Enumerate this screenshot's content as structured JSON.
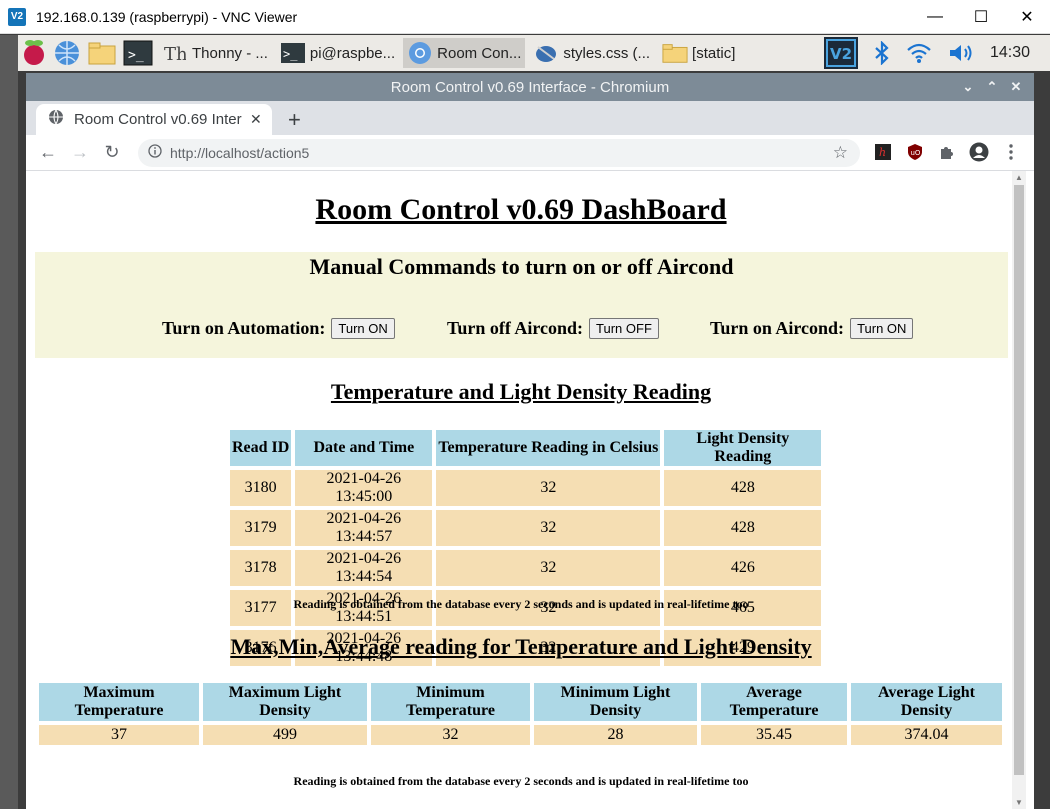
{
  "vnc": {
    "title": "192.168.0.139 (raspberrypi) - VNC Viewer"
  },
  "panel": {
    "tasks": [
      "Thonny  -  ...",
      "pi@raspbe...",
      "Room Con...",
      "styles.css (...",
      "[static]"
    ],
    "clock": "14:30"
  },
  "chrome": {
    "window_title": "Room Control v0.69 Interface - Chromium",
    "tab_title": "Room Control v0.69 Inter",
    "url": "http://localhost/action5"
  },
  "page": {
    "title": "Room Control v0.69 DashBoard",
    "manual": {
      "title": "Manual Commands to turn on or off Aircond",
      "commands": [
        {
          "label": "Turn on Automation:",
          "button": "Turn ON"
        },
        {
          "label": "Turn off Aircond:",
          "button": "Turn OFF"
        },
        {
          "label": "Turn on Aircond:",
          "button": "Turn ON"
        }
      ]
    },
    "readings_title": "Temperature and Light Density Reading",
    "readings_headers": [
      "Read ID",
      "Date and Time",
      "Temperature Reading in Celsius",
      "Light Density Reading"
    ],
    "readings": [
      [
        "3180",
        "2021-04-26 13:45:00",
        "32",
        "428"
      ],
      [
        "3179",
        "2021-04-26 13:44:57",
        "32",
        "428"
      ],
      [
        "3178",
        "2021-04-26 13:44:54",
        "32",
        "426"
      ],
      [
        "3177",
        "2021-04-26 13:44:51",
        "32",
        "465"
      ],
      [
        "3176",
        "2021-04-26 13:44:48",
        "32",
        "429"
      ]
    ],
    "note": "Reading is obtained from the database every 2 seconds and is updated in real-lifetime too",
    "stats_title": "Max,Min,Average reading for Temperature and Light Density",
    "stats_headers": [
      "Maximum Temperature",
      "Maximum Light Density",
      "Minimum Temperature",
      "Minimum Light Density",
      "Average Temperature",
      "Average Light Density"
    ],
    "stats_values": [
      "37",
      "499",
      "32",
      "28",
      "35.45",
      "374.04"
    ]
  }
}
